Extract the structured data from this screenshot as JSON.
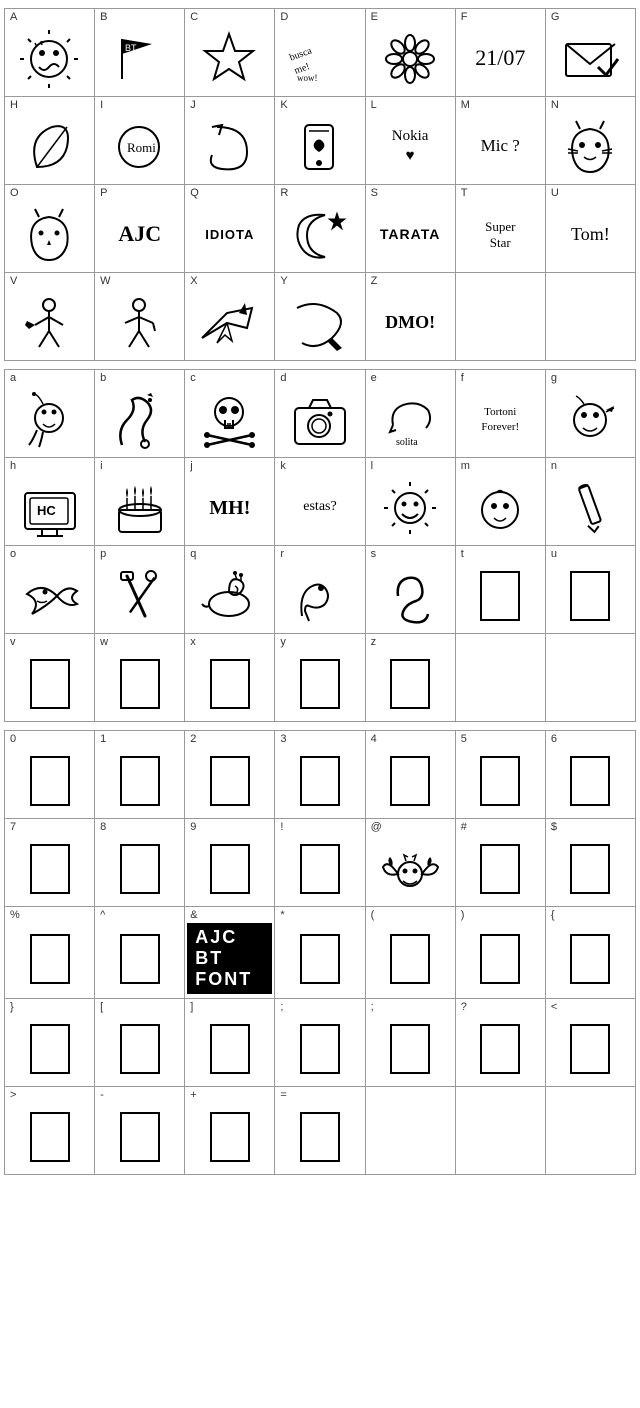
{
  "sections": [
    {
      "id": "uppercase",
      "cells": [
        {
          "label": "A",
          "type": "svg",
          "key": "sun_face"
        },
        {
          "label": "B",
          "type": "svg",
          "key": "flag_letters"
        },
        {
          "label": "C",
          "type": "svg",
          "key": "star"
        },
        {
          "label": "D",
          "type": "svg",
          "key": "buscame"
        },
        {
          "label": "E",
          "type": "svg",
          "key": "flower"
        },
        {
          "label": "F",
          "type": "text",
          "text": "21/07"
        },
        {
          "label": "G",
          "type": "svg",
          "key": "envelope_check"
        },
        {
          "label": "H",
          "type": "svg",
          "key": "leaf_swirl"
        },
        {
          "label": "I",
          "type": "svg",
          "key": "romi"
        },
        {
          "label": "J",
          "type": "svg",
          "key": "j_swirl"
        },
        {
          "label": "K",
          "type": "svg",
          "key": "k_swirl"
        },
        {
          "label": "L",
          "type": "text",
          "text": "Nokia ♥"
        },
        {
          "label": "M",
          "type": "text",
          "text": "Mic ?"
        },
        {
          "label": "N",
          "type": "svg",
          "key": "cat_face"
        },
        {
          "label": "O",
          "type": "svg",
          "key": "cat_outline"
        },
        {
          "label": "P",
          "type": "text",
          "text": "AJC"
        },
        {
          "label": "Q",
          "type": "text",
          "text": "IDIOTA"
        },
        {
          "label": "R",
          "type": "svg",
          "key": "moon_star"
        },
        {
          "label": "S",
          "type": "text",
          "text": "TARATA"
        },
        {
          "label": "T",
          "type": "text",
          "text": "Super Star"
        },
        {
          "label": "U",
          "type": "text",
          "text": "Tom!"
        },
        {
          "label": "V",
          "type": "svg",
          "key": "stick_figure"
        },
        {
          "label": "W",
          "type": "svg",
          "key": "stick_figure2"
        },
        {
          "label": "X",
          "type": "svg",
          "key": "plane"
        },
        {
          "label": "Y",
          "type": "svg",
          "key": "y_swoosh"
        },
        {
          "label": "Z",
          "type": "text",
          "text": "DMO!"
        }
      ]
    },
    {
      "id": "lowercase",
      "cells": [
        {
          "label": "a",
          "type": "svg",
          "key": "a_creature"
        },
        {
          "label": "b",
          "type": "svg",
          "key": "b_snake"
        },
        {
          "label": "c",
          "type": "svg",
          "key": "skull"
        },
        {
          "label": "d",
          "type": "svg",
          "key": "camera"
        },
        {
          "label": "e",
          "type": "text",
          "text": "solita"
        },
        {
          "label": "f",
          "type": "text",
          "text": "Tortoni Forever!"
        },
        {
          "label": "g",
          "type": "svg",
          "key": "g_creature"
        },
        {
          "label": "h",
          "type": "svg",
          "key": "tv_hc"
        },
        {
          "label": "i",
          "type": "svg",
          "key": "cake"
        },
        {
          "label": "j",
          "type": "text",
          "text": "MH!"
        },
        {
          "label": "k",
          "type": "text",
          "text": "estas?"
        },
        {
          "label": "l",
          "type": "svg",
          "key": "sun_smile"
        },
        {
          "label": "m",
          "type": "svg",
          "key": "m_face"
        },
        {
          "label": "n",
          "type": "svg",
          "key": "pencil"
        },
        {
          "label": "o",
          "type": "svg",
          "key": "fish"
        },
        {
          "label": "p",
          "type": "svg",
          "key": "tools"
        },
        {
          "label": "q",
          "type": "svg",
          "key": "snail"
        },
        {
          "label": "r",
          "type": "svg",
          "key": "r_creature"
        },
        {
          "label": "s",
          "type": "svg",
          "key": "s_hand"
        },
        {
          "label": "t",
          "type": "empty"
        },
        {
          "label": "u",
          "type": "empty"
        },
        {
          "label": "v",
          "type": "empty"
        },
        {
          "label": "w",
          "type": "empty"
        },
        {
          "label": "x",
          "type": "empty"
        },
        {
          "label": "y",
          "type": "empty"
        },
        {
          "label": "z",
          "type": "empty"
        }
      ]
    },
    {
      "id": "numbers",
      "cells": [
        {
          "label": "0",
          "type": "empty"
        },
        {
          "label": "1",
          "type": "empty"
        },
        {
          "label": "2",
          "type": "empty"
        },
        {
          "label": "3",
          "type": "empty"
        },
        {
          "label": "4",
          "type": "empty"
        },
        {
          "label": "5",
          "type": "empty"
        },
        {
          "label": "6",
          "type": "empty"
        },
        {
          "label": "7",
          "type": "empty"
        },
        {
          "label": "8",
          "type": "empty"
        },
        {
          "label": "9",
          "type": "empty"
        },
        {
          "label": "!",
          "type": "empty"
        },
        {
          "label": "@",
          "type": "svg",
          "key": "bat_face"
        },
        {
          "label": "#",
          "type": "empty"
        },
        {
          "label": "$",
          "type": "empty"
        },
        {
          "label": "%",
          "type": "empty"
        },
        {
          "label": "^",
          "type": "empty"
        },
        {
          "label": "&",
          "type": "ajc",
          "text": "AJC BT FONT"
        },
        {
          "label": "*",
          "type": "empty"
        },
        {
          "label": "(",
          "type": "empty"
        },
        {
          "label": ")",
          "type": "empty"
        },
        {
          "label": "{",
          "type": "empty"
        },
        {
          "label": "}",
          "type": "empty"
        },
        {
          "label": "[",
          "type": "empty"
        },
        {
          "label": "]",
          "type": "empty"
        },
        {
          "label": ";",
          "type": "empty"
        },
        {
          "label": ";",
          "type": "empty"
        },
        {
          "label": "?",
          "type": "empty"
        },
        {
          "label": "<",
          "type": "empty"
        },
        {
          "label": ">",
          "type": "empty"
        },
        {
          "label": "-",
          "type": "empty"
        },
        {
          "label": "+",
          "type": "empty"
        },
        {
          "label": "=",
          "type": "empty"
        }
      ]
    }
  ]
}
